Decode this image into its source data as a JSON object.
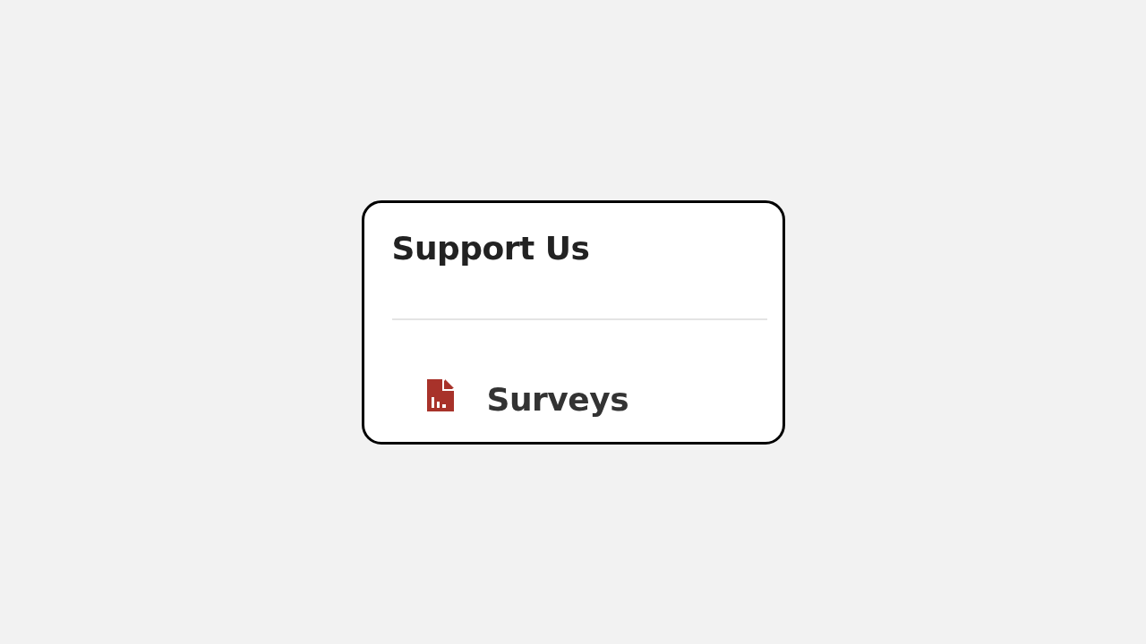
{
  "card": {
    "title": "Support Us",
    "links": [
      {
        "label": "Surveys"
      }
    ]
  }
}
